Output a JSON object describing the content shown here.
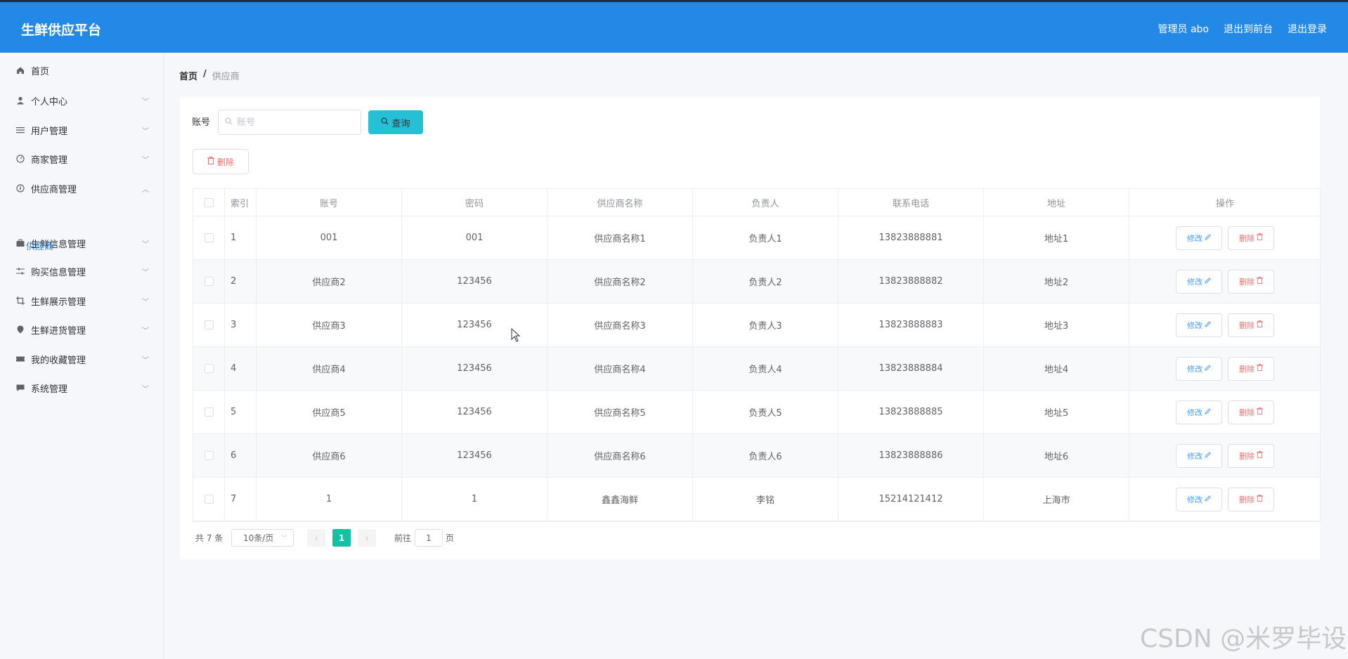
{
  "header": {
    "brand": "生鲜供应平台",
    "links": [
      "管理员 abo",
      "退出到前台",
      "退出登录"
    ]
  },
  "sidebar": {
    "items": [
      {
        "label": "首页",
        "icon": "home-icon",
        "arrow": ""
      },
      {
        "label": "个人中心",
        "icon": "user-icon",
        "arrow": "﹀"
      },
      {
        "label": "用户管理",
        "icon": "list-icon",
        "arrow": "﹀"
      },
      {
        "label": "商家管理",
        "icon": "dashboard-icon",
        "arrow": "﹀"
      },
      {
        "label": "供应商管理",
        "icon": "compass-icon",
        "arrow": "︿"
      },
      {
        "label": "生鲜信息管理",
        "icon": "briefcase-icon",
        "arrow": "﹀"
      },
      {
        "label": "购买信息管理",
        "icon": "sliders-icon",
        "arrow": "﹀"
      },
      {
        "label": "生鲜展示管理",
        "icon": "crop-icon",
        "arrow": "﹀"
      },
      {
        "label": "生鲜进货管理",
        "icon": "location-icon",
        "arrow": "﹀"
      },
      {
        "label": "我的收藏管理",
        "icon": "ticket-icon",
        "arrow": "﹀"
      },
      {
        "label": "系统管理",
        "icon": "chat-icon",
        "arrow": "﹀"
      }
    ],
    "submenu": {
      "label": "供应商"
    }
  },
  "breadcrumb": {
    "home": "首页",
    "sep": "/",
    "current": "供应商"
  },
  "search": {
    "label": "账号",
    "placeholder": "账号",
    "value": "",
    "button": "查询"
  },
  "toolbar": {
    "delete_label": "删除"
  },
  "table": {
    "headers": [
      "索引",
      "账号",
      "密码",
      "供应商名称",
      "负责人",
      "联系电话",
      "地址",
      "操作"
    ],
    "rows": [
      [
        "1",
        "001",
        "001",
        "供应商名称1",
        "负责人1",
        "13823888881",
        "地址1"
      ],
      [
        "2",
        "供应商2",
        "123456",
        "供应商名称2",
        "负责人2",
        "13823888882",
        "地址2"
      ],
      [
        "3",
        "供应商3",
        "123456",
        "供应商名称3",
        "负责人3",
        "13823888883",
        "地址3"
      ],
      [
        "4",
        "供应商4",
        "123456",
        "供应商名称4",
        "负责人4",
        "13823888884",
        "地址4"
      ],
      [
        "5",
        "供应商5",
        "123456",
        "供应商名称5",
        "负责人5",
        "13823888885",
        "地址5"
      ],
      [
        "6",
        "供应商6",
        "123456",
        "供应商名称6",
        "负责人6",
        "13823888886",
        "地址6"
      ],
      [
        "7",
        "1",
        "1",
        "鑫鑫海鲜",
        "李铭",
        "15214121412",
        "上海市"
      ]
    ],
    "edit_label": "修改",
    "delete_label": "删除"
  },
  "pagination": {
    "total": "共 7 条",
    "page_size": "10条/页",
    "current_page": "1",
    "goto_label": "前往",
    "goto_value": "1",
    "goto_unit": "页"
  },
  "watermark": "CSDN @米罗毕设",
  "colors": {
    "header": "#2389e6",
    "search_button": "#25c0d6",
    "current_page": "#13c2a3",
    "danger": "#f56c6c",
    "primary": "#409eff"
  }
}
